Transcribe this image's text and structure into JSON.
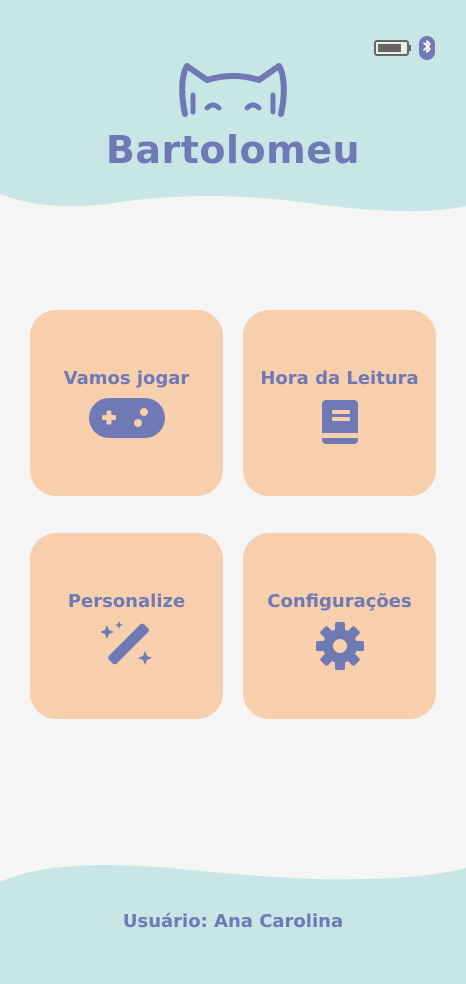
{
  "header": {
    "brand_name": "Bartolomeu"
  },
  "menu": {
    "games_label": "Vamos jogar",
    "reading_label": "Hora da Leitura",
    "customize_label": "Personalize",
    "settings_label": "Configurações"
  },
  "footer": {
    "user_text": "Usuário: Ana Carolina"
  },
  "icons": {
    "battery": "battery-icon",
    "bluetooth": "bluetooth-icon",
    "cat": "cat-face-icon",
    "games": "gamepad-icon",
    "reading": "book-icon",
    "customize": "magic-wand-icon",
    "settings": "gear-icon"
  },
  "colors": {
    "accent": "#6f79b4",
    "card_bg": "#f7cfad",
    "header_bg": "#c8e6e6",
    "page_bg": "#f5f5f5"
  }
}
